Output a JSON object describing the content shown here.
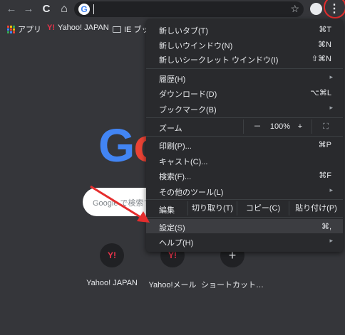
{
  "toolbar": {
    "back": "←",
    "forward": "→",
    "reload": "C",
    "home": "⌂",
    "star": "☆",
    "menu": "⋮"
  },
  "bookmarks": [
    {
      "label": "アプリ",
      "icon": "apps-grid-icon"
    },
    {
      "label": "Yahoo! JAPAN",
      "icon": "yahoo-icon"
    },
    {
      "label": "IE ブッ",
      "icon": "folder-icon"
    }
  ],
  "content": {
    "google_letters": [
      {
        "ch": "G",
        "color": "#4285f4"
      },
      {
        "ch": "o",
        "color": "#ea4335"
      }
    ],
    "search_placeholder": "Google で検索す",
    "shortcuts": [
      {
        "label": "Yahoo! JAPAN",
        "icon": "Y!"
      },
      {
        "label": "Yahoo!メール",
        "icon": "Y!"
      },
      {
        "label": "ショートカット…",
        "icon": "+"
      }
    ]
  },
  "menu": {
    "items": [
      {
        "label": "新しいタブ(T)",
        "shortcut": "⌘T"
      },
      {
        "label": "新しいウインドウ(N)",
        "shortcut": "⌘N"
      },
      {
        "label": "新しいシークレット ウインドウ(I)",
        "shortcut": "⇧⌘N"
      },
      {
        "label": "履歴(H)",
        "shortcut": "▸"
      },
      {
        "label": "ダウンロード(D)",
        "shortcut": "⌥⌘L"
      },
      {
        "label": "ブックマーク(B)",
        "shortcut": "▸"
      },
      {
        "label": "印刷(P)...",
        "shortcut": "⌘P"
      },
      {
        "label": "キャスト(C)...",
        "shortcut": ""
      },
      {
        "label": "検索(F)...",
        "shortcut": "⌘F"
      },
      {
        "label": "その他のツール(L)",
        "shortcut": "▸"
      },
      {
        "label": "設定(S)",
        "shortcut": "⌘,"
      },
      {
        "label": "ヘルプ(H)",
        "shortcut": "▸"
      }
    ],
    "zoom": {
      "label": "ズーム",
      "minus": "－",
      "value": "100%",
      "plus": "+",
      "fullscreen": "⛶"
    },
    "edit": {
      "label": "編集",
      "cut": "切り取り(T)",
      "copy": "コピー(C)",
      "paste": "貼り付け(P)"
    }
  },
  "colors": {
    "annotation": "#e52d2d",
    "menu_bg": "#292a2d",
    "page_bg": "#35363a"
  }
}
